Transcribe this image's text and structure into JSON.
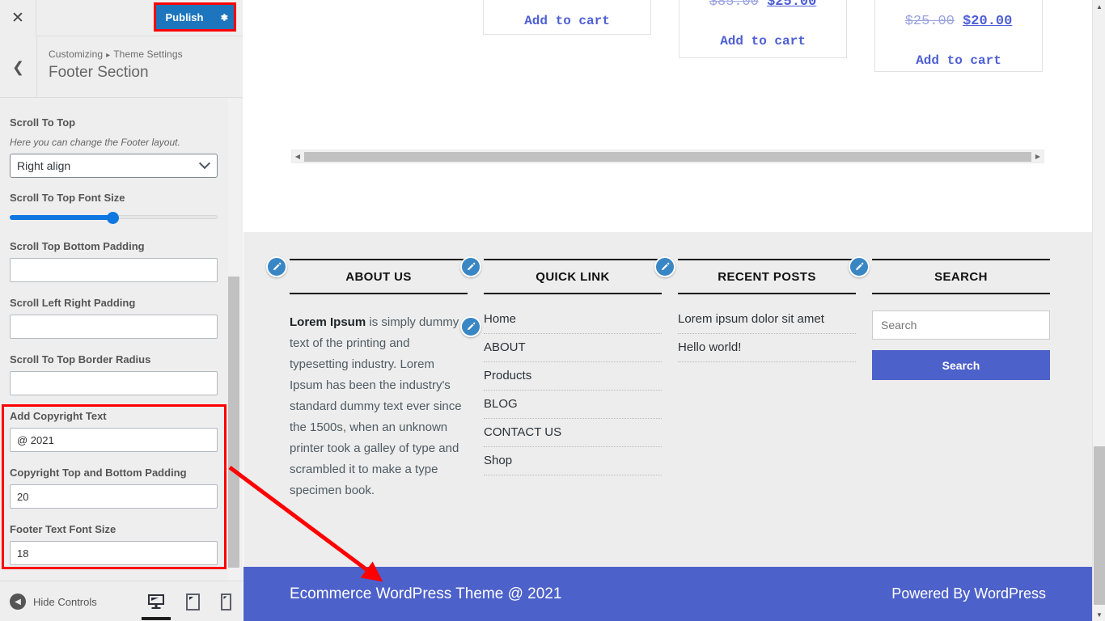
{
  "customizer": {
    "close_icon": "close-icon",
    "publish_label": "Publish",
    "gear_icon": "gear-icon",
    "back_icon": "chevron-left-icon",
    "breadcrumb_root": "Customizing",
    "breadcrumb_sep": "▸",
    "breadcrumb_parent": "Theme Settings",
    "panel_title": "Footer Section",
    "accent_blue": "#1d76bd",
    "highlight_red": "#ff0000"
  },
  "controls": [
    {
      "label": "Scroll To Top",
      "description": "Here you can change the Footer layout.",
      "type": "select",
      "value": "Right align"
    },
    {
      "label": "Scroll To Top Font Size",
      "type": "range",
      "value": 50
    },
    {
      "label": "Scroll Top Bottom Padding",
      "type": "text",
      "value": ""
    },
    {
      "label": "Scroll Left Right Padding",
      "type": "text",
      "value": ""
    },
    {
      "label": "Scroll To Top Border Radius",
      "type": "text",
      "value": ""
    },
    {
      "label": "Add Copyright Text",
      "type": "text",
      "value": "@ 2021"
    },
    {
      "label": "Copyright Top and Bottom Padding",
      "type": "text",
      "value": "20"
    },
    {
      "label": "Footer Text Font Size",
      "type": "text",
      "value": "18"
    }
  ],
  "sidebar_footer": {
    "hide_controls_label": "Hide Controls",
    "collapse_icon": "collapse-arrow-icon",
    "devices": [
      {
        "name": "desktop-preview",
        "icon": "desktop-icon",
        "active": true
      },
      {
        "name": "tablet-preview",
        "icon": "tablet-icon",
        "active": false
      },
      {
        "name": "mobile-preview",
        "icon": "mobile-icon",
        "active": false
      }
    ]
  },
  "preview": {
    "products": [
      {
        "add_to_cart": "Add to cart",
        "price_old": "",
        "price_new": ""
      },
      {
        "add_to_cart": "Add to cart",
        "price_old": "$85.00",
        "price_new": "$25.00"
      },
      {
        "add_to_cart": "Add to cart",
        "price_old": "$25.00",
        "price_new": "$20.00"
      }
    ],
    "widgets": {
      "about": {
        "title": "ABOUT US",
        "lead": "Lorem Ipsum",
        "body": " is simply dummy text of the printing and typesetting industry. Lorem Ipsum has been the industry's standard dummy text ever since the 1500s, when an unknown printer took a galley of type and scrambled it to make a type specimen book."
      },
      "quick_link": {
        "title": "QUICK LINK",
        "items": [
          "Home",
          "ABOUT",
          "Products",
          "BLOG",
          "CONTACT US",
          "Shop"
        ]
      },
      "recent_posts": {
        "title": "RECENT POSTS",
        "items": [
          "Lorem ipsum dolor sit amet",
          "Hello world!"
        ]
      },
      "search": {
        "title": "SEARCH",
        "placeholder": "Search",
        "button_label": "Search"
      }
    },
    "copyright": {
      "left": "Ecommerce WordPress Theme @ 2021",
      "right": "Powered By WordPress",
      "background": "#4d61ca"
    },
    "edit_icon_name": "pencil-edit-icon"
  }
}
